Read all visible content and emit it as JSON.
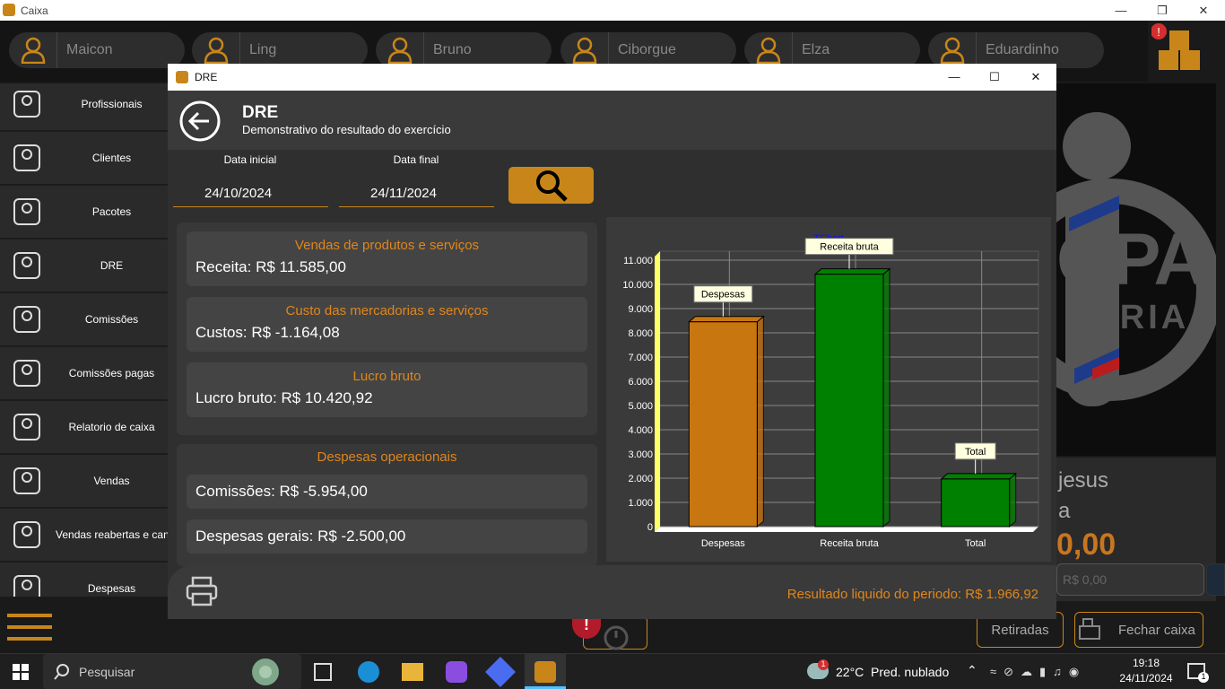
{
  "window": {
    "title": "Caixa"
  },
  "users": [
    "Maicon",
    "Ling",
    "Bruno",
    "Ciborgue",
    "Elza",
    "Eduardinho"
  ],
  "sidebar": [
    {
      "label": "Profissionais",
      "icon": "professional-icon"
    },
    {
      "label": "Clientes",
      "icon": "client-icon"
    },
    {
      "label": "Pacotes",
      "icon": "package-icon"
    },
    {
      "label": "DRE",
      "icon": "chart-icon"
    },
    {
      "label": "Comissões",
      "icon": "commission-icon"
    },
    {
      "label": "Comissões pagas",
      "icon": "paid-icon"
    },
    {
      "label": "Relatorio de caixa",
      "icon": "register-icon"
    },
    {
      "label": "Vendas",
      "icon": "sales-icon"
    },
    {
      "label": "Vendas reabertas e canceladas",
      "icon": "cancel-icon"
    },
    {
      "label": "Despesas",
      "icon": "expense-icon"
    }
  ],
  "background": {
    "logo_text_1": "OPA",
    "logo_text_2": "EARIA",
    "name_1": "jesus",
    "name_2": "a",
    "value": "0,00",
    "sub_value": "R$ 0,00",
    "retiradas_label": "Retiradas",
    "fechar_label": "Fechar caixa"
  },
  "dialog": {
    "title": "DRE",
    "header_title": "DRE",
    "header_subtitle": "Demonstrativo do resultado do exercício",
    "date_start_label": "Data inicial",
    "date_start": "24/10/2024",
    "date_end_label": "Data final",
    "date_end": "24/11/2024",
    "cards": [
      {
        "title": "Vendas de produtos e serviços",
        "value": "Receita: R$ 11.585,00"
      },
      {
        "title": "Custo das mercadorias e serviços",
        "value": "Custos: R$ -1.164,08"
      },
      {
        "title": "Lucro bruto",
        "value": "Lucro bruto: R$ 10.420,92"
      }
    ],
    "despesas_title": "Despesas operacionais",
    "despesas": [
      "Comissões: R$ -5.954,00",
      "Despesas gerais: R$ -2.500,00"
    ],
    "footer_result": "Resultado liquido do periodo: R$ 1.966,92"
  },
  "chart_data": {
    "type": "bar",
    "title": "TChart",
    "categories": [
      "Despesas",
      "Receita bruta",
      "Total"
    ],
    "values": [
      8454,
      10421,
      1967
    ],
    "colors": [
      "#c8760f",
      "#008000",
      "#008000"
    ],
    "ylim": [
      0,
      11000
    ],
    "yticks": [
      "0",
      "1.000",
      "2.000",
      "3.000",
      "4.000",
      "5.000",
      "6.000",
      "7.000",
      "8.000",
      "9.000",
      "10.000",
      "11.000"
    ],
    "labels": [
      "Despesas",
      "Receita bruta",
      "Total"
    ],
    "grid": true
  },
  "taskbar": {
    "search_placeholder": "Pesquisar",
    "weather": "22°C  Pred. nublado",
    "time": "19:18",
    "date": "24/11/2024",
    "notif_count": "1",
    "weather_badge": "1"
  }
}
